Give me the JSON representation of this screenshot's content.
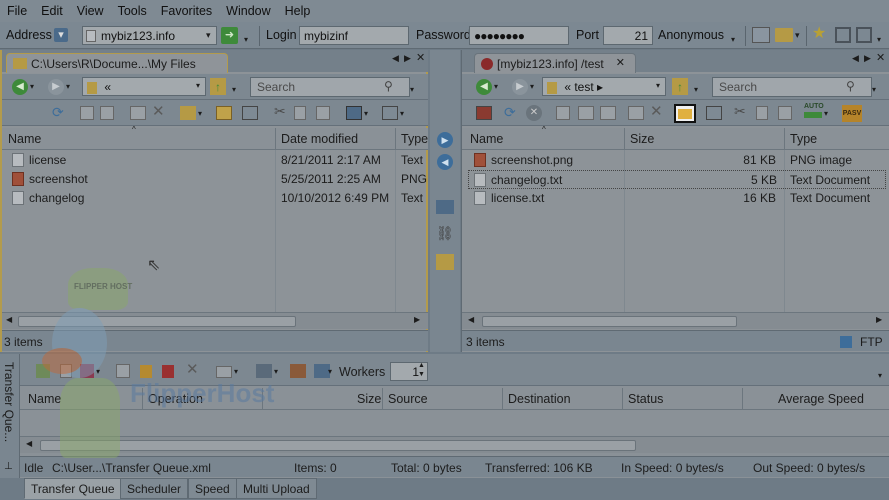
{
  "menu": [
    "File",
    "Edit",
    "View",
    "Tools",
    "Favorites",
    "Window",
    "Help"
  ],
  "address_bar": {
    "address_label": "Address",
    "address_value": "mybiz123.info",
    "login_label": "Login",
    "login_value": "mybizinf",
    "password_label": "Password",
    "password_value": "●●●●●●●●",
    "port_label": "Port",
    "port_value": "21",
    "anonymous_label": "Anonymous"
  },
  "left_pane": {
    "tab_title": "C:\\Users\\R\\Docume...\\My Files",
    "path_value": "«",
    "search_placeholder": "Search",
    "columns": [
      "Name",
      "Date modified",
      "Type"
    ],
    "files": [
      {
        "name": "license",
        "date": "8/21/2011 2:17 AM",
        "type": "Text",
        "icon": "text-file-icon"
      },
      {
        "name": "screenshot",
        "date": "5/25/2011 2:25 AM",
        "type": "PNG",
        "icon": "image-file-icon"
      },
      {
        "name": "changelog",
        "date": "10/10/2012 6:49 PM",
        "type": "Text",
        "icon": "text-file-icon"
      }
    ],
    "status": "3 items"
  },
  "right_pane": {
    "tab_title": "[mybiz123.info] /test",
    "path_value": "«  test  ▸",
    "search_placeholder": "Search",
    "columns": [
      "Name",
      "Size",
      "Type"
    ],
    "files": [
      {
        "name": "screenshot.png",
        "size": "81 KB",
        "type": "PNG image",
        "icon": "image-file-icon"
      },
      {
        "name": "changelog.txt",
        "size": "5 KB",
        "type": "Text Document",
        "icon": "text-file-icon"
      },
      {
        "name": "license.txt",
        "size": "16 KB",
        "type": "Text Document",
        "icon": "text-file-icon"
      }
    ],
    "status": "3 items",
    "protocol": "FTP",
    "pasv_label": "PASV",
    "auto_label": "AUTO"
  },
  "transfer_queue": {
    "side_label": "Transfer Que...",
    "workers_label": "Workers",
    "workers_value": "1",
    "columns": [
      "Name",
      "Operation",
      "Size",
      "Source",
      "Destination",
      "Status",
      "Average Speed"
    ],
    "status": {
      "state": "Idle",
      "file": "C:\\User...\\Transfer Queue.xml",
      "items": "Items: 0",
      "total": "Total: 0 bytes",
      "transferred": "Transferred: 106 KB",
      "in_speed": "In Speed: 0 bytes/s",
      "out_speed": "Out Speed: 0 bytes/s"
    }
  },
  "bottom_tabs": [
    "Transfer Queue",
    "Scheduler",
    "Speed",
    "Multi Upload"
  ],
  "watermark": {
    "badge_text": "FLIPPER HOST",
    "brand_text": "FlipperHost"
  },
  "colors": {
    "accent_border": "#b39b4c",
    "selected_highlight": "#f0f0f0"
  }
}
